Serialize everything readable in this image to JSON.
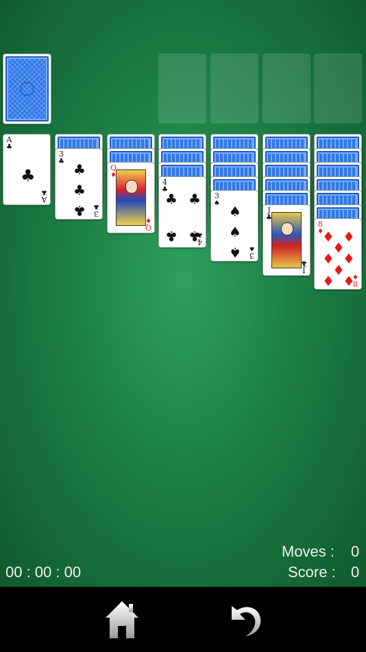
{
  "hud": {
    "timer": "00 : 00 : 00",
    "moves_label": "Moves :",
    "moves_value": "0",
    "score_label": "Score :",
    "score_value": "0"
  },
  "tableau": [
    {
      "face_down": 0,
      "face_up": [
        {
          "rank": "A",
          "suit": "♣",
          "color": "black"
        }
      ]
    },
    {
      "face_down": 1,
      "face_up": [
        {
          "rank": "3",
          "suit": "♣",
          "color": "black"
        }
      ]
    },
    {
      "face_down": 2,
      "face_up": [
        {
          "rank": "Q",
          "suit": "♦",
          "color": "red"
        }
      ]
    },
    {
      "face_down": 3,
      "face_up": [
        {
          "rank": "4",
          "suit": "♣",
          "color": "black"
        }
      ]
    },
    {
      "face_down": 4,
      "face_up": [
        {
          "rank": "3",
          "suit": "♠",
          "color": "black"
        }
      ]
    },
    {
      "face_down": 5,
      "face_up": [
        {
          "rank": "J",
          "suit": "♣",
          "color": "black"
        }
      ]
    },
    {
      "face_down": 6,
      "face_up": [
        {
          "rank": "8",
          "suit": "♦",
          "color": "red"
        }
      ]
    }
  ],
  "foundations": 4,
  "colors": {
    "felt": "#1c7f45",
    "card_back": "#2f78e8",
    "red_suit": "#e31b1b",
    "black_suit": "#111111"
  },
  "icons": [
    "stock-card-back",
    "home-icon",
    "undo-icon"
  ]
}
